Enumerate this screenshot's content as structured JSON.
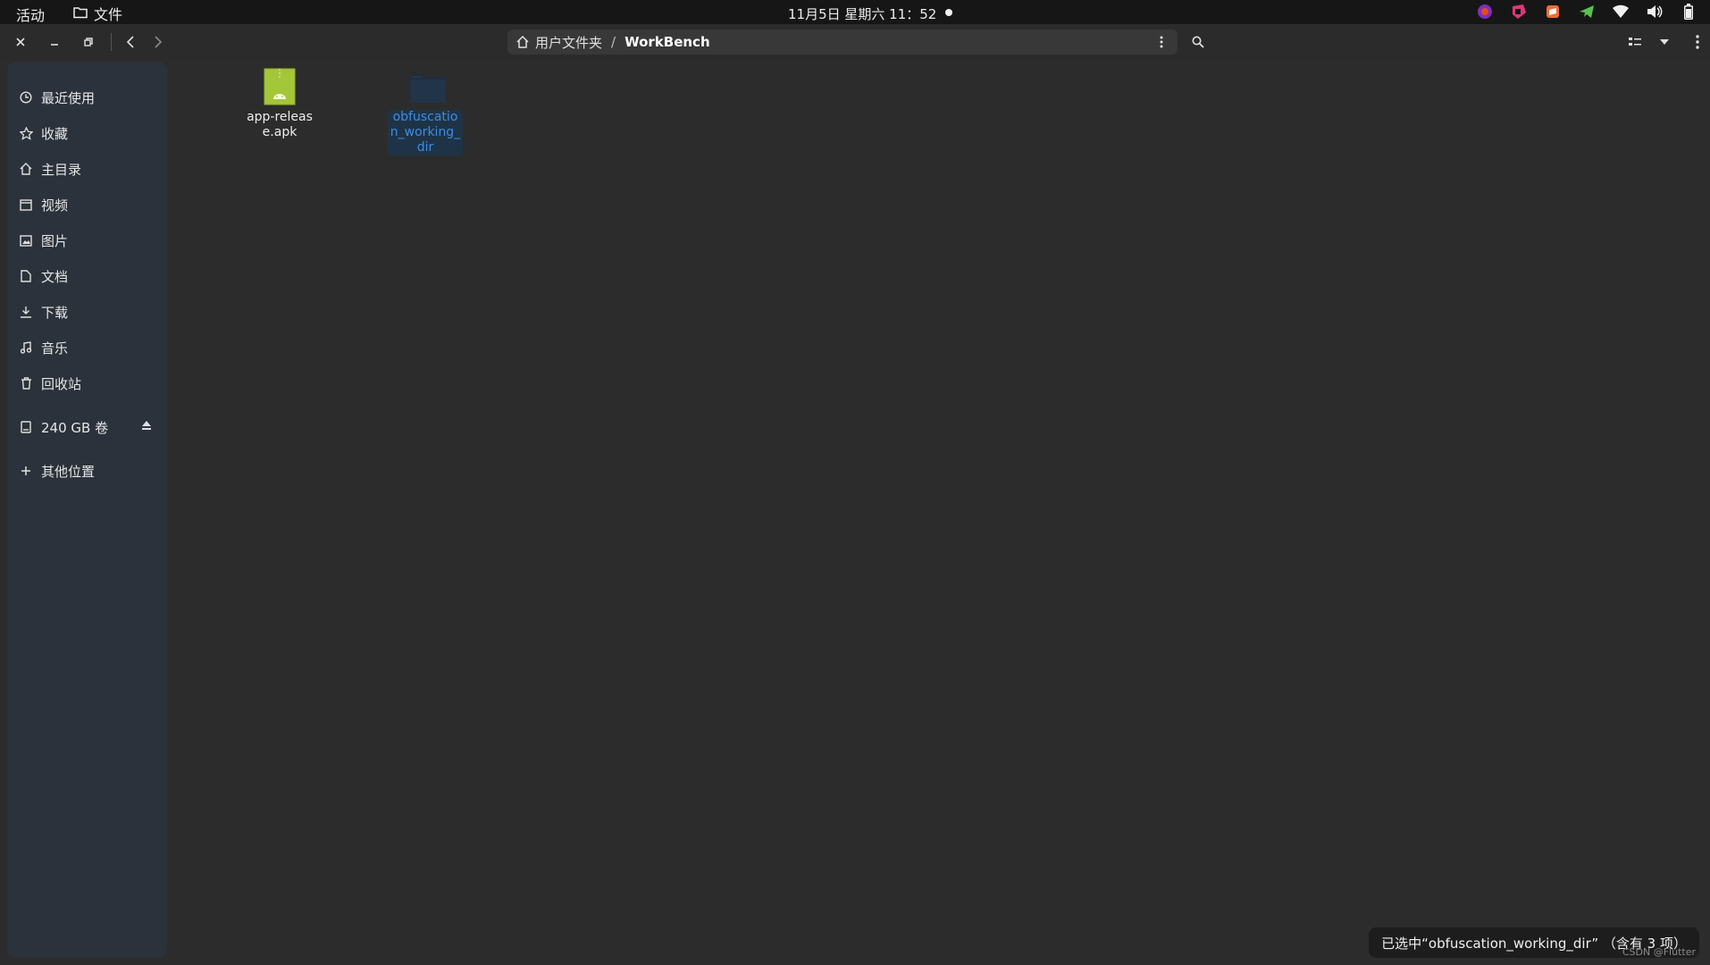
{
  "topbar": {
    "activities": "活动",
    "app_name": "文件",
    "clock": "11月5日 星期六 11：52"
  },
  "tray_icons": [
    "blender-icon",
    "jetbrains-toolbox-icon",
    "sublime-icon",
    "telegram-icon",
    "wifi-icon",
    "volume-icon",
    "battery-icon"
  ],
  "header": {
    "path": {
      "home_label": "用户文件夹",
      "separator": "/",
      "current": "WorkBench"
    }
  },
  "sidebar": {
    "items": [
      {
        "label": "最近使用",
        "icon": "clock-icon"
      },
      {
        "label": "收藏",
        "icon": "star-icon"
      },
      {
        "label": "主目录",
        "icon": "home-icon"
      },
      {
        "label": "视频",
        "icon": "video-icon"
      },
      {
        "label": "图片",
        "icon": "image-icon"
      },
      {
        "label": "文档",
        "icon": "document-icon"
      },
      {
        "label": "下载",
        "icon": "download-icon"
      },
      {
        "label": "音乐",
        "icon": "music-icon"
      },
      {
        "label": "回收站",
        "icon": "trash-icon"
      }
    ],
    "volume": {
      "label": "240 GB 卷",
      "icon": "drive-icon"
    },
    "other_locations": {
      "label": "其他位置",
      "icon": "plus-icon"
    }
  },
  "files": [
    {
      "name": "app-release.apk",
      "type": "apk",
      "selected": false
    },
    {
      "name": "obfuscation_working_dir",
      "type": "folder",
      "selected": true
    }
  ],
  "status": {
    "text": "已选中“obfuscation_working_dir” （含有 3 项）"
  },
  "watermark": "CSDN @Flutter",
  "colors": {
    "accent": "#3a8ee6",
    "sidebar_bg": "#2b323b",
    "content_bg": "#2c2c2c",
    "apk_green": "#a4c639"
  }
}
